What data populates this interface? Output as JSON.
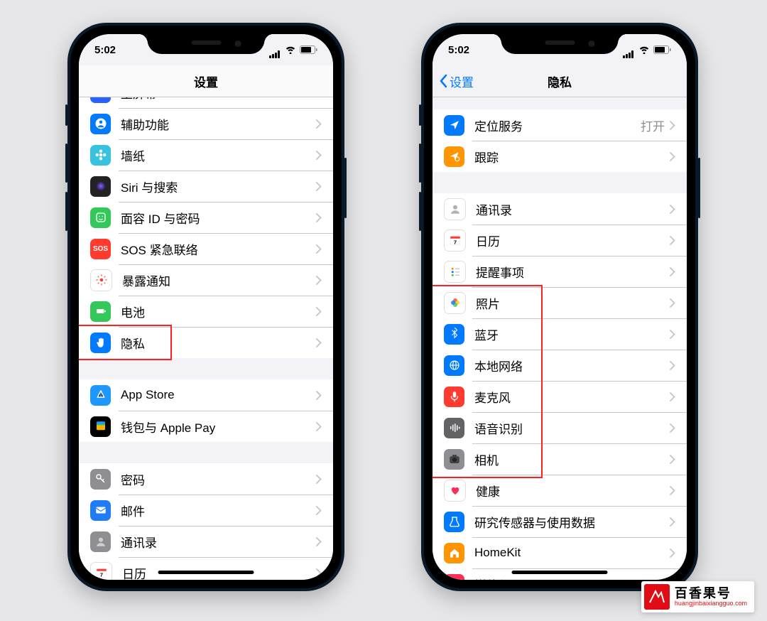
{
  "status": {
    "time": "5:02"
  },
  "left": {
    "title": "设置",
    "groups": [
      {
        "margin": "first",
        "rows": [
          {
            "name": "home-screen",
            "icon": {
              "bg": "#2962ff",
              "t": "grid"
            },
            "label": "主屏幕",
            "clipped": true
          },
          {
            "name": "accessibility",
            "icon": {
              "bg": "#007aff",
              "t": "person"
            },
            "label": "辅助功能"
          },
          {
            "name": "wallpaper",
            "icon": {
              "bg": "#37c2e0",
              "t": "flower"
            },
            "label": "墙纸"
          },
          {
            "name": "siri-search",
            "icon": {
              "bg": "grad-siri",
              "t": "siri"
            },
            "label": "Siri 与搜索"
          },
          {
            "name": "faceid-passcode",
            "icon": {
              "bg": "#34c759",
              "t": "face"
            },
            "label": "面容 ID 与密码"
          },
          {
            "name": "sos",
            "icon": {
              "bg": "#ff3b30",
              "t": "sos"
            },
            "label": "SOS 紧急联络"
          },
          {
            "name": "exposure",
            "icon": {
              "bg": "#fff",
              "t": "expo",
              "bd": 1
            },
            "label": "暴露通知"
          },
          {
            "name": "battery",
            "icon": {
              "bg": "#34c759",
              "t": "batt"
            },
            "label": "电池"
          },
          {
            "name": "privacy",
            "icon": {
              "bg": "#007aff",
              "t": "hand"
            },
            "label": "隐私",
            "highlight": true
          }
        ]
      },
      {
        "rows": [
          {
            "name": "app-store",
            "icon": {
              "bg": "#1e98ff",
              "t": "astore"
            },
            "label": "App Store"
          },
          {
            "name": "wallet-applepay",
            "icon": {
              "bg": "#000",
              "t": "wallet"
            },
            "label": "钱包与 Apple Pay"
          }
        ]
      },
      {
        "rows": [
          {
            "name": "passwords",
            "icon": {
              "bg": "#8e8e93",
              "t": "key"
            },
            "label": "密码"
          },
          {
            "name": "mail",
            "icon": {
              "bg": "#1f7cf6",
              "t": "mail"
            },
            "label": "邮件"
          },
          {
            "name": "contacts",
            "icon": {
              "bg": "#8e8e93",
              "t": "contact"
            },
            "label": "通讯录"
          },
          {
            "name": "calendar",
            "icon": {
              "bg": "#fff",
              "t": "cal",
              "bd": 1
            },
            "label": "日历",
            "clipped_bottom": true
          }
        ]
      }
    ]
  },
  "right": {
    "title": "隐私",
    "back": "设置",
    "highlight_box": true,
    "groups": [
      {
        "margin": "tight",
        "rows": [
          {
            "name": "location-services",
            "icon": {
              "bg": "#007aff",
              "t": "loc"
            },
            "label": "定位服务",
            "detail": "打开"
          },
          {
            "name": "tracking",
            "icon": {
              "bg": "#ff9500",
              "t": "track"
            },
            "label": "跟踪"
          }
        ]
      },
      {
        "rows": [
          {
            "name": "contacts",
            "icon": {
              "bg": "#fff",
              "t": "contact2",
              "bd": 1
            },
            "label": "通讯录"
          },
          {
            "name": "calendars",
            "icon": {
              "bg": "#fff",
              "t": "cal2",
              "bd": 1
            },
            "label": "日历"
          },
          {
            "name": "reminders",
            "icon": {
              "bg": "#fff",
              "t": "rem",
              "bd": 1
            },
            "label": "提醒事项"
          },
          {
            "name": "photos",
            "icon": {
              "bg": "#fff",
              "t": "photos",
              "bd": 1
            },
            "label": "照片"
          },
          {
            "name": "bluetooth",
            "icon": {
              "bg": "#007aff",
              "t": "bt"
            },
            "label": "蓝牙"
          },
          {
            "name": "local-network",
            "icon": {
              "bg": "#007aff",
              "t": "net"
            },
            "label": "本地网络"
          },
          {
            "name": "microphone",
            "icon": {
              "bg": "#ff3b30",
              "t": "mic"
            },
            "label": "麦克风"
          },
          {
            "name": "speech",
            "icon": {
              "bg": "#636366",
              "t": "wave"
            },
            "label": "语音识别"
          },
          {
            "name": "camera",
            "icon": {
              "bg": "#8e8e93",
              "t": "cam"
            },
            "label": "相机"
          },
          {
            "name": "health",
            "icon": {
              "bg": "#fff",
              "t": "heart",
              "bd": 1
            },
            "label": "健康"
          },
          {
            "name": "research",
            "icon": {
              "bg": "#007aff",
              "t": "research"
            },
            "label": "研究传感器与使用数据"
          },
          {
            "name": "homekit",
            "icon": {
              "bg": "#ff9500",
              "t": "home"
            },
            "label": "HomeKit"
          },
          {
            "name": "media",
            "icon": {
              "bg": "#ff2d55",
              "t": "music"
            },
            "label": "媒体与 Apple Music",
            "clipped_bottom": true
          }
        ]
      }
    ]
  },
  "watermark": {
    "title": "百香果号",
    "sub": "huangjinbaixiangguo.com"
  }
}
